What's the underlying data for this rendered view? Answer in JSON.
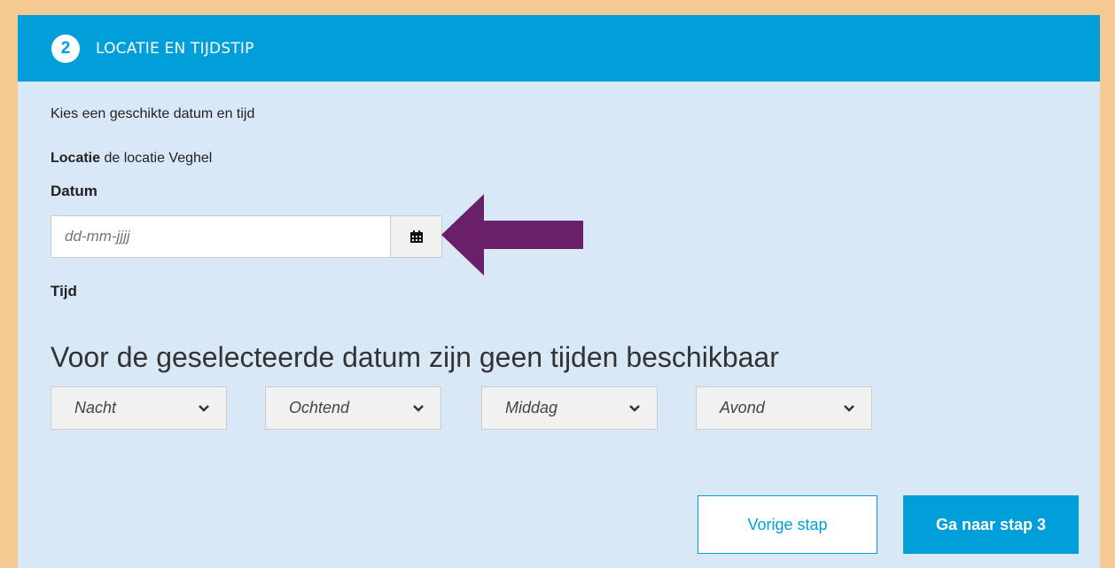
{
  "header": {
    "step_number": "2",
    "title": "LOCATIE EN TIJDSTIP"
  },
  "intro_text": "Kies een geschikte datum en tijd",
  "location": {
    "label": "Locatie",
    "value": "de locatie Veghel"
  },
  "date": {
    "label": "Datum",
    "placeholder": "dd-mm-jjjj",
    "calendar_icon": "calendar-icon"
  },
  "time": {
    "label": "Tijd",
    "notice": "Voor de geselecteerde datum zijn geen tijden beschikbaar"
  },
  "time_selects": [
    {
      "value": "Nacht"
    },
    {
      "value": "Ochtend"
    },
    {
      "value": "Middag"
    },
    {
      "value": "Avond"
    }
  ],
  "buttons": {
    "previous": "Vorige stap",
    "next": "Ga naar stap 3"
  },
  "colors": {
    "accent": "#009fd9",
    "panel_bg": "#d9e8f6",
    "page_bg": "#f5c992",
    "annotation_arrow": "#6a2068"
  }
}
